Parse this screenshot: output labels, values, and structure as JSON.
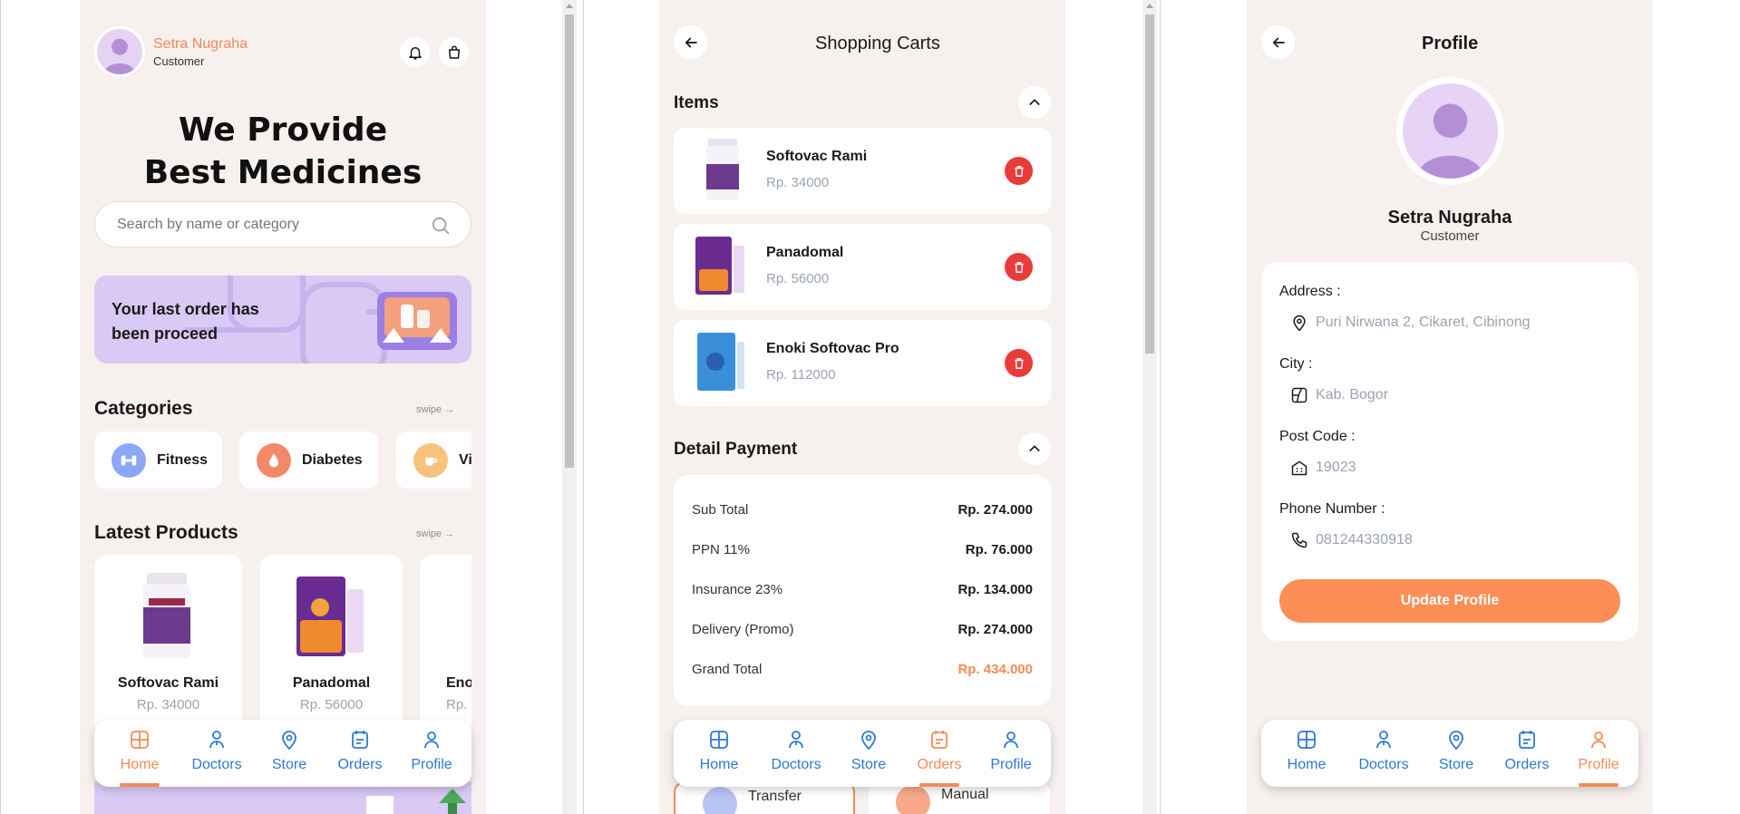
{
  "home": {
    "user": {
      "name": "Setra Nugraha",
      "role": "Customer"
    },
    "hero_line1": "We Provide",
    "hero_line2": "Best Medicines",
    "search_placeholder": "Search by name or category",
    "banner_text": "Your last order has been proceed",
    "categories_title": "Categories",
    "categories_swipe": "swipe",
    "categories": [
      {
        "label": "Fitness",
        "color": "#8aa8f5",
        "icon": "dumbbell-icon"
      },
      {
        "label": "Diabetes",
        "color": "#f4896a",
        "icon": "drop-icon"
      },
      {
        "label": "Vi",
        "color": "#f9c27c",
        "icon": "cup-icon"
      }
    ],
    "latest_title": "Latest Products",
    "latest_swipe": "swipe",
    "products": [
      {
        "name": "Softovac Rami",
        "price": "Rp. 34000"
      },
      {
        "name": "Panadomal",
        "price": "Rp. 56000"
      },
      {
        "name": "Eno",
        "price": "Rp."
      }
    ]
  },
  "cart": {
    "title": "Shopping Carts",
    "items_title": "Items",
    "items": [
      {
        "name": "Softovac Rami",
        "price": "Rp. 34000"
      },
      {
        "name": "Panadomal",
        "price": "Rp. 56000"
      },
      {
        "name": "Enoki Softovac Pro",
        "price": "Rp. 112000"
      }
    ],
    "payment_title": "Detail Payment",
    "payment": [
      {
        "label": "Sub Total",
        "value": "Rp. 274.000"
      },
      {
        "label": "PPN 11%",
        "value": "Rp. 76.000"
      },
      {
        "label": "Insurance 23%",
        "value": "Rp. 134.000"
      },
      {
        "label": "Delivery (Promo)",
        "value": "Rp. 274.000"
      },
      {
        "label": "Grand Total",
        "value": "Rp. 434.000"
      }
    ],
    "methods": [
      "Transfer",
      "Manual"
    ]
  },
  "profile": {
    "title": "Profile",
    "name": "Setra Nugraha",
    "role": "Customer",
    "fields": [
      {
        "label": "Address :",
        "value": "Puri Nirwana 2, Cikaret, Cibinong",
        "icon": "location-pin-icon"
      },
      {
        "label": "City :",
        "value": "Kab. Bogor",
        "icon": "map-icon"
      },
      {
        "label": "Post Code :",
        "value": "19023",
        "icon": "building-icon"
      },
      {
        "label": "Phone Number :",
        "value": "081244330918",
        "icon": "phone-icon"
      }
    ],
    "update_label": "Update Profile"
  },
  "nav": {
    "items": [
      "Home",
      "Doctors",
      "Store",
      "Orders",
      "Profile"
    ],
    "active_home": "Home",
    "active_cart": "Orders",
    "active_profile": "Profile"
  },
  "colors": {
    "accent": "#f58a54",
    "nav_blue": "#2c78d6",
    "background": "#f6f0ee",
    "danger": "#ea3b3b"
  }
}
